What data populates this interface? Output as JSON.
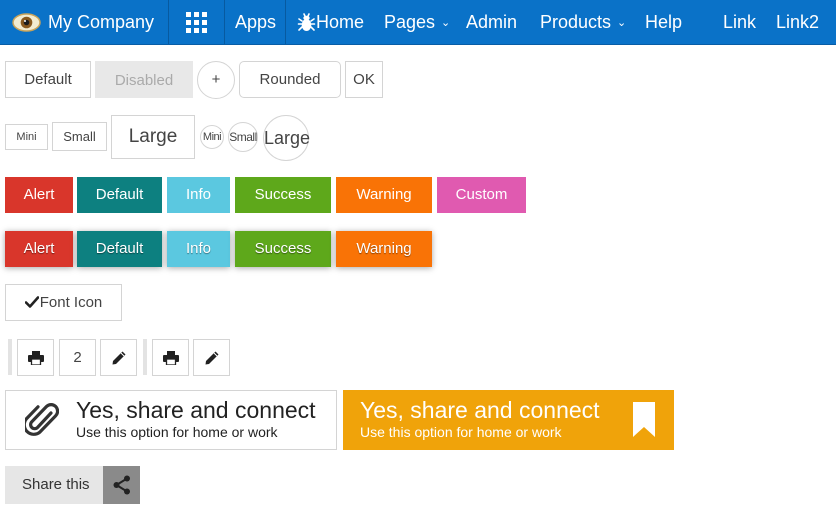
{
  "nav": {
    "brand": "My Company",
    "apps": "Apps",
    "home": "Home",
    "pages": "Pages",
    "admin": "Admin",
    "products": "Products",
    "help": "Help",
    "link": "Link",
    "link2": "Link2",
    "colors": {
      "background": "#0a72c8"
    }
  },
  "row_basic": {
    "default": "Default",
    "disabled": "Disabled",
    "plus": "+",
    "rounded": "Rounded",
    "ok": "OK"
  },
  "row_sizes": {
    "mini": "Mini",
    "small": "Small",
    "large": "Large",
    "round_mini": "Mini",
    "round_small": "Small",
    "round_large": "Large"
  },
  "row_colors": {
    "alert": "Alert",
    "default": "Default",
    "info": "Info",
    "success": "Success",
    "warning": "Warning",
    "custom": "Custom"
  },
  "row_colors_shadow": {
    "alert": "Alert",
    "default": "Default",
    "info": "Info",
    "success": "Success",
    "warning": "Warning"
  },
  "colors": {
    "alert": "#d9362b",
    "default": "#0d8080",
    "info": "#5bc8e0",
    "success": "#5ea81b",
    "warning": "#f97306",
    "custom": "#e05ab0",
    "share_orange": "#f0a30a",
    "share_gray": "#8a8a8a"
  },
  "font_icon": {
    "label": "Font Icon",
    "icon": "check-icon"
  },
  "toolbar": {
    "count": "2",
    "icons": [
      "print-icon",
      "pencil-icon",
      "print-icon",
      "pencil-icon"
    ]
  },
  "share_white": {
    "title": "Yes, share and connect",
    "subtitle": "Use this option for home or work",
    "icon": "paperclip-icon"
  },
  "share_orange": {
    "title": "Yes, share and connect",
    "subtitle": "Use this option for home or work",
    "icon": "bookmark-icon"
  },
  "share_this": {
    "label": "Share this",
    "icon": "share-icon"
  }
}
